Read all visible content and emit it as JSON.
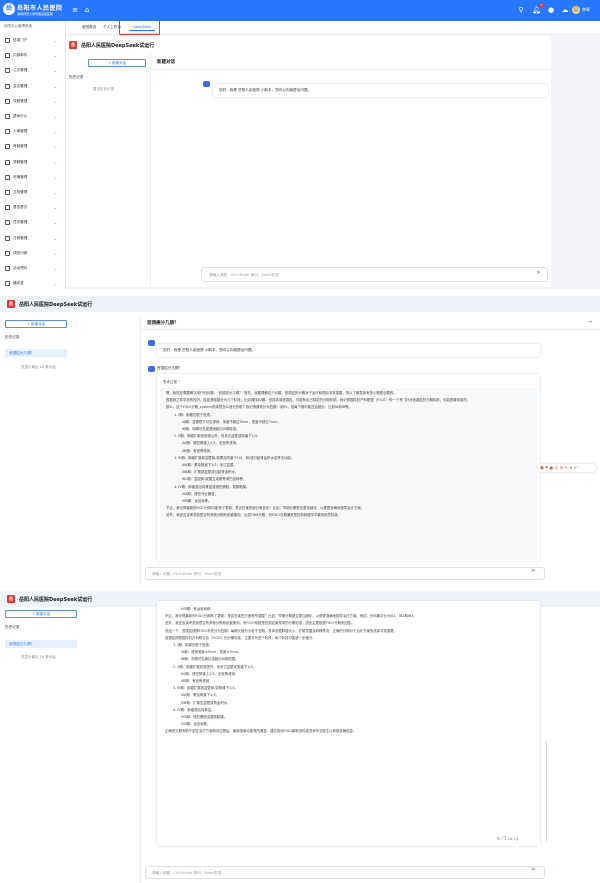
{
  "app": {
    "brand_cn": "岳阳市人民医院",
    "brand_sub": "湖南师范大学附属岳阳医院",
    "user": "李晖",
    "notif_count": "5"
  },
  "sidebar": {
    "title": "协同办公管理系统",
    "items": [
      {
        "label": "信息门户"
      },
      {
        "label": "内部邮件"
      },
      {
        "label": "公文管理"
      },
      {
        "label": "会议管理"
      },
      {
        "label": "流程管理"
      },
      {
        "label": "退休中心"
      },
      {
        "label": "人事管理"
      },
      {
        "label": "考勤管理"
      },
      {
        "label": "请假管理"
      },
      {
        "label": "车辆管理"
      },
      {
        "label": "文档管理"
      },
      {
        "label": "督查督办"
      },
      {
        "label": "任务管理"
      },
      {
        "label": "日程管理"
      },
      {
        "label": "调查问卷"
      },
      {
        "label": "活动预约"
      },
      {
        "label": "通讯录"
      }
    ]
  },
  "tabs": [
    {
      "label": "医院首页"
    },
    {
      "label": "个人工作台"
    },
    {
      "label": "DeepSeek"
    }
  ],
  "deepseek": {
    "page_title": "岳阳人民医院DeepSeek试运行",
    "logo_char": "岳",
    "new_chat": "+ 新建对话",
    "history_title": "历史记录",
    "history_empty": "暂无历史记录",
    "new_conv_title": "新建对话",
    "greeting": "您好，我是 岳阳人民医院 小助手，您可以向我提出问题。",
    "greeting2": "您好，我是 岳阳人民医院 小助手，您可以向我提出问题。",
    "input_placeholder": "请输入问题，Ctrl+Enter 换行，Enter发送",
    "question": "宫颈癌分几期？",
    "history_item": "宫颈癌分几期？",
    "history_more": "仅显示最近 20 条对话",
    "think_label": "思考过程 ^"
  },
  "thinking": [
    {
      "cls": "",
      "t": "嗯，我现在需要解决用户的问题：“宫颈癌分几期？”首先，我要理解这个问题。宫颈癌的分期对于治疗和预后非常重要，所以了解具体有多少期是必要的。"
    },
    {
      "cls": "",
      "t": "根据我之前学到的知识，癌症通常被分为几个阶段，比如I期到IV期。但具体到宫颈癌，可能有自己特定的分期系统。我记得国际妇产科联盟（FIGO）有一个专门针对宫颈癌的分期标准，可能是最常用的。"
    },
    {
      "cls": "",
      "t": "那么，这个FIGO分期_system具体是怎么划分的呢？我记得通常分为四期：I到IV，但每个期可能还会细分，比如IA和IB等。"
    },
    {
      "cls": "in1",
      "t": "1. I期：肿瘤仅限于宫颈。"
    },
    {
      "cls": "in2",
      "t": "IA期：显微镜下可见浸润，深度不超过5mm，宽度不超过7mm。"
    },
    {
      "cls": "in2",
      "t": "IB期：肉眼可见或浸润超出IA期标准。"
    },
    {
      "cls": "in1",
      "t": "2. II期：肿瘤扩散到宫颈以外，但未达盆壁或阴道下1/3。"
    },
    {
      "cls": "in2",
      "t": "IIA期：侵犯阴道上2/3，无宫旁浸润。"
    },
    {
      "cls": "in2",
      "t": "IIB期：有宫旁浸润。"
    },
    {
      "cls": "in1",
      "t": "3. III期：肿瘤扩展到盆壁和/或累及阴道下1/3，和/或引起肾盂积水或肾无功能。"
    },
    {
      "cls": "in2",
      "t": "IIIA期：累及阴道下1/3，未达盆壁。"
    },
    {
      "cls": "in2",
      "t": "IIIB期：扩展到盆壁或引起肾盂积水。"
    },
    {
      "cls": "in2",
      "t": "IIIC期：盆腔和/或腹主动脉旁淋巴结转移。"
    },
    {
      "cls": "in1",
      "t": "4. IV期：肿瘤超出真骨盆或侵犯膀胱、直肠黏膜。"
    },
    {
      "cls": "in2",
      "t": "IVA期：侵犯邻近器官。"
    },
    {
      "cls": "in2",
      "t": "IVB期：远处转移。"
    },
    {
      "cls": "",
      "t": "不过，我记得最新的FIGO分期可能有了更新，是否在某些部分有变化？比如，早期分期是否更加细化，以便更准确地指导治疗方案。"
    },
    {
      "cls": "",
      "t": "此外，我还应该考虑到是否有其他分期系统被使用，比如TNM分期，但FIGO分期通常是妇科肿瘤学中最常用的标准。"
    }
  ],
  "answer": [
    {
      "cls": "in2",
      "t": "IVB期：有远处转移。"
    },
    {
      "cls": "",
      "t": "不过，我记得最新的FIGO分期有了更新，是否在某些方面有所调整？比如，早期分期是否更加细化，以便更准确地指导治疗方案。例如，在IB期中分为IB1、IB2和IB3。"
    },
    {
      "cls": "",
      "t": "此外，我还应该考虑到是否有其他分期系统被使用，但FIGO系统是宫颈癌最常用的分期标准，因此主要依据FIGO分期来回答。"
    },
    {
      "cls": "",
      "t": "总结一下，宫颈癌按照FIGO系统分为四期，每期又细分为若干亚期，具体依据肿瘤大小、扩散范围及转移情况。正确的分期对于治疗方案的选择非常重要。"
    },
    {
      "cls": "",
      "t": "宫颈癌按照国际妇产科联合会（FIGO）的分期标准，主要分为四个阶段，每个阶段可能进一步细分："
    },
    {
      "cls": "in1",
      "t": "1. I期：肿瘤仅限于宫颈。"
    },
    {
      "cls": "in2",
      "t": "IA期：浸润深度≤5mm，宽度≤7mm。"
    },
    {
      "cls": "in2",
      "t": "IB期：肉眼可见病灶或超出IA期范围。"
    },
    {
      "cls": "in1",
      "t": "2. II期：肿瘤扩展到宫颈外，但未达盆壁或阴道下1/3。"
    },
    {
      "cls": "in2",
      "t": "IIA期：侵犯阴道上2/3，无宫旁浸润。"
    },
    {
      "cls": "in2",
      "t": "IIB期：有宫旁浸润。"
    },
    {
      "cls": "in1",
      "t": "3. III期：肿瘤扩展到盆壁和/或阴道下1/3。"
    },
    {
      "cls": "in2",
      "t": "IIIA期：累及阴道下1/3。"
    },
    {
      "cls": "in2",
      "t": "IIIB期：扩展至盆壁或肾盂积水。"
    },
    {
      "cls": "in1",
      "t": "4. IV期：肿瘤超出真骨盆。"
    },
    {
      "cls": "in2",
      "t": "IVA期：侵犯膀胱或直肠黏膜。"
    },
    {
      "cls": "in2",
      "t": "IVB期：远处转移。"
    },
    {
      "cls": "",
      "t": "正确的分期有助于制定治疗方案和评估预后。最新指南可能有所调整，建议查阅FIGO最新资料或咨询专业医生以获取准确信息。"
    }
  ]
}
